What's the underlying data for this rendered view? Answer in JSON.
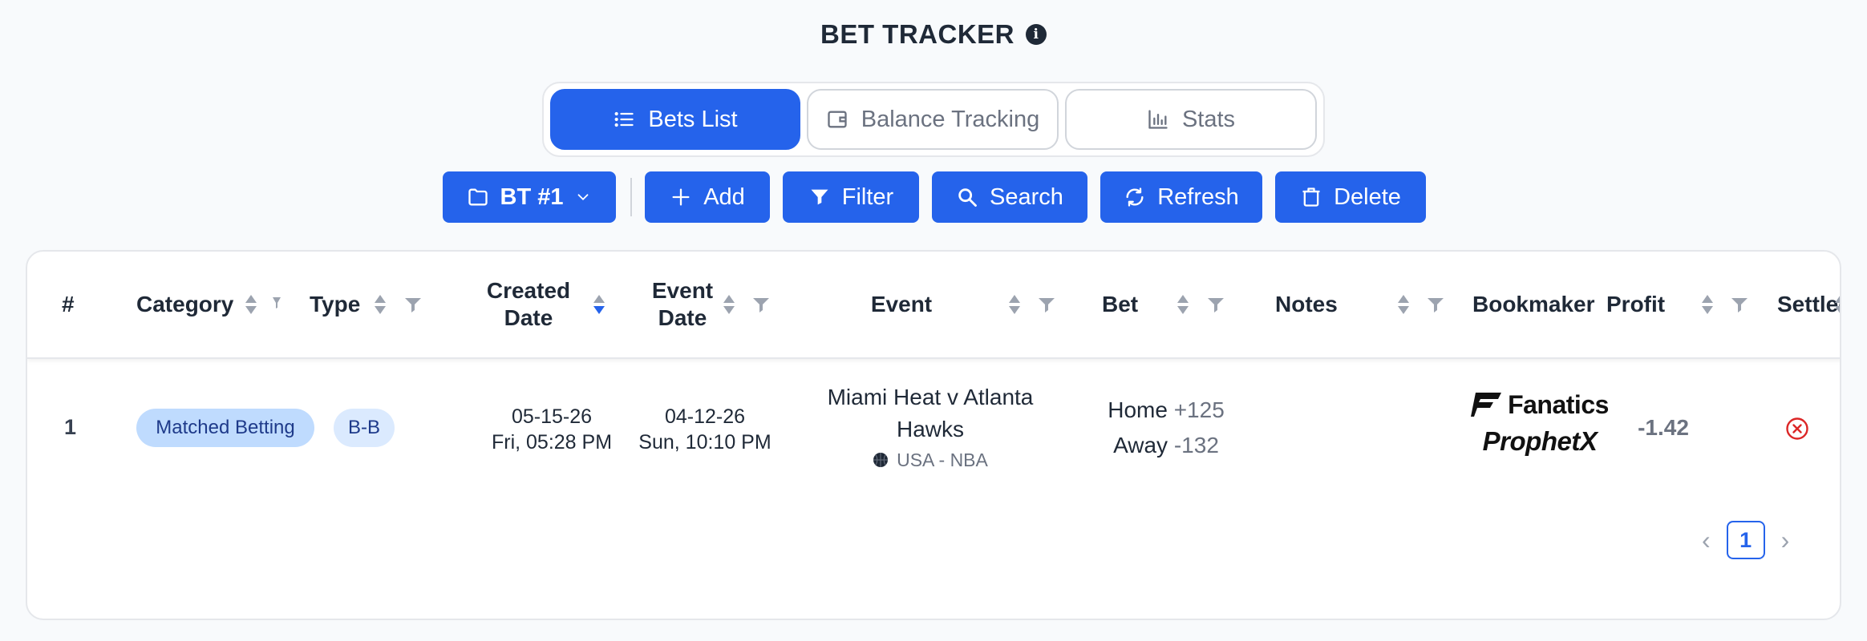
{
  "app": {
    "title": "BET TRACKER"
  },
  "tabs": [
    {
      "label": "Bets List",
      "icon": "list-icon",
      "active": true
    },
    {
      "label": "Balance Tracking",
      "icon": "wallet-icon",
      "active": false
    },
    {
      "label": "Stats",
      "icon": "bar-chart-icon",
      "active": false
    }
  ],
  "toolbar": {
    "tracker_label": "BT #1",
    "add_label": "Add",
    "filter_label": "Filter",
    "search_label": "Search",
    "refresh_label": "Refresh",
    "delete_label": "Delete"
  },
  "columns": {
    "num": "#",
    "category": "Category",
    "type": "Type",
    "created_line1": "Created",
    "created_line2": "Date",
    "event_date_line1": "Event",
    "event_date_line2": "Date",
    "event": "Event",
    "bet": "Bet",
    "notes": "Notes",
    "bookmaker": "Bookmaker",
    "profit": "Profit",
    "settled": "Settled"
  },
  "rows": [
    {
      "num": "1",
      "category": "Matched Betting",
      "type": "B-B",
      "created_date": "05-15-26",
      "created_time": "Fri, 05:28 PM",
      "event_date": "04-12-26",
      "event_time": "Sun, 10:10 PM",
      "event_line1": "Miami Heat v Atlanta",
      "event_line2": "Hawks",
      "event_league": "USA - NBA",
      "bet_home_label": "Home",
      "bet_home_odds": "+125",
      "bet_away_label": "Away",
      "bet_away_odds": "-132",
      "notes": "",
      "bookmaker_1": "Fanatics",
      "bookmaker_2": "ProphetX",
      "profit": "-1.42",
      "settled": false
    }
  ],
  "pagination": {
    "current_page": "1"
  },
  "colors": {
    "primary": "#2563eb",
    "error": "#dc2626",
    "background": "#f8fafc"
  }
}
